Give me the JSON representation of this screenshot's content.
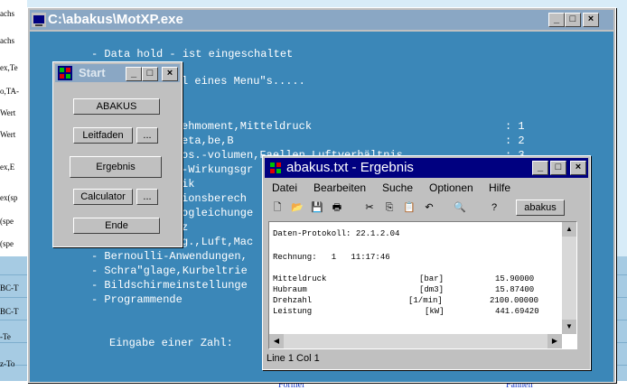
{
  "background": {
    "left_cells": [
      "achs",
      "achs",
      "ex,Te",
      "o,TA-",
      "Wert",
      "Wert",
      "ex,E",
      "ex(sp",
      "(spe",
      "(spe",
      "BC-T",
      "BC-T",
      "-Te",
      "z-To"
    ],
    "bottom": [
      "Formel",
      "Fähnelr"
    ]
  },
  "console": {
    "title": "C:\\abakus\\MotXP.exe",
    "lines": [
      "- Data hold - ist eingeschaltet",
      "l eines Menu\"s.....",
      "ehmoment,Mitteldruck",
      "eta,be,B",
      "os.-volumen,Faellen Luftverhältnis",
      "-Wirkungsgr",
      "ik",
      "ionsberech",
      "ogleichunge",
      "z",
      "g.,Luft,Mac",
      "- Bernoulli-Anwendungen,",
      "- Schra\"glage,Kurbeltrie",
      "- Bildschirmeinstellunge",
      "- Programmende",
      "Eingabe einer Zahl:"
    ],
    "menu_numbers": [
      ": 1",
      ": 2",
      ": 3"
    ],
    "buttons": {
      "min": "_",
      "max": "□",
      "close": "×"
    }
  },
  "start": {
    "title": "Start",
    "buttons": {
      "abakus": "ABAKUS",
      "leitfaden": "Leitfaden",
      "ergebnis": "Ergebnis",
      "calculator": "Calculator",
      "ende": "Ende",
      "small": "..."
    }
  },
  "ergebnis": {
    "title": "abakus.txt - Ergebnis",
    "menu": [
      "Datei",
      "Bearbeiten",
      "Suche",
      "Optionen",
      "Hilfe"
    ],
    "toolbar_label": "abakus",
    "doc": {
      "protokoll": "Daten-Protokoll: 22.1.2.04",
      "rechnung": "Rechnung:   1   11:17:46",
      "rows": [
        {
          "name": "Mitteldruck",
          "unit": "[bar]",
          "value": "15.90000"
        },
        {
          "name": "Hubraum",
          "unit": "[dm3]",
          "value": "15.87400"
        },
        {
          "name": "Drehzahl",
          "unit": "[1/min]",
          "value": "2100.00000"
        },
        {
          "name": "Leistung",
          "unit": "[kW]",
          "value": "441.69420"
        }
      ]
    },
    "status": "Line 1  Col 1"
  }
}
